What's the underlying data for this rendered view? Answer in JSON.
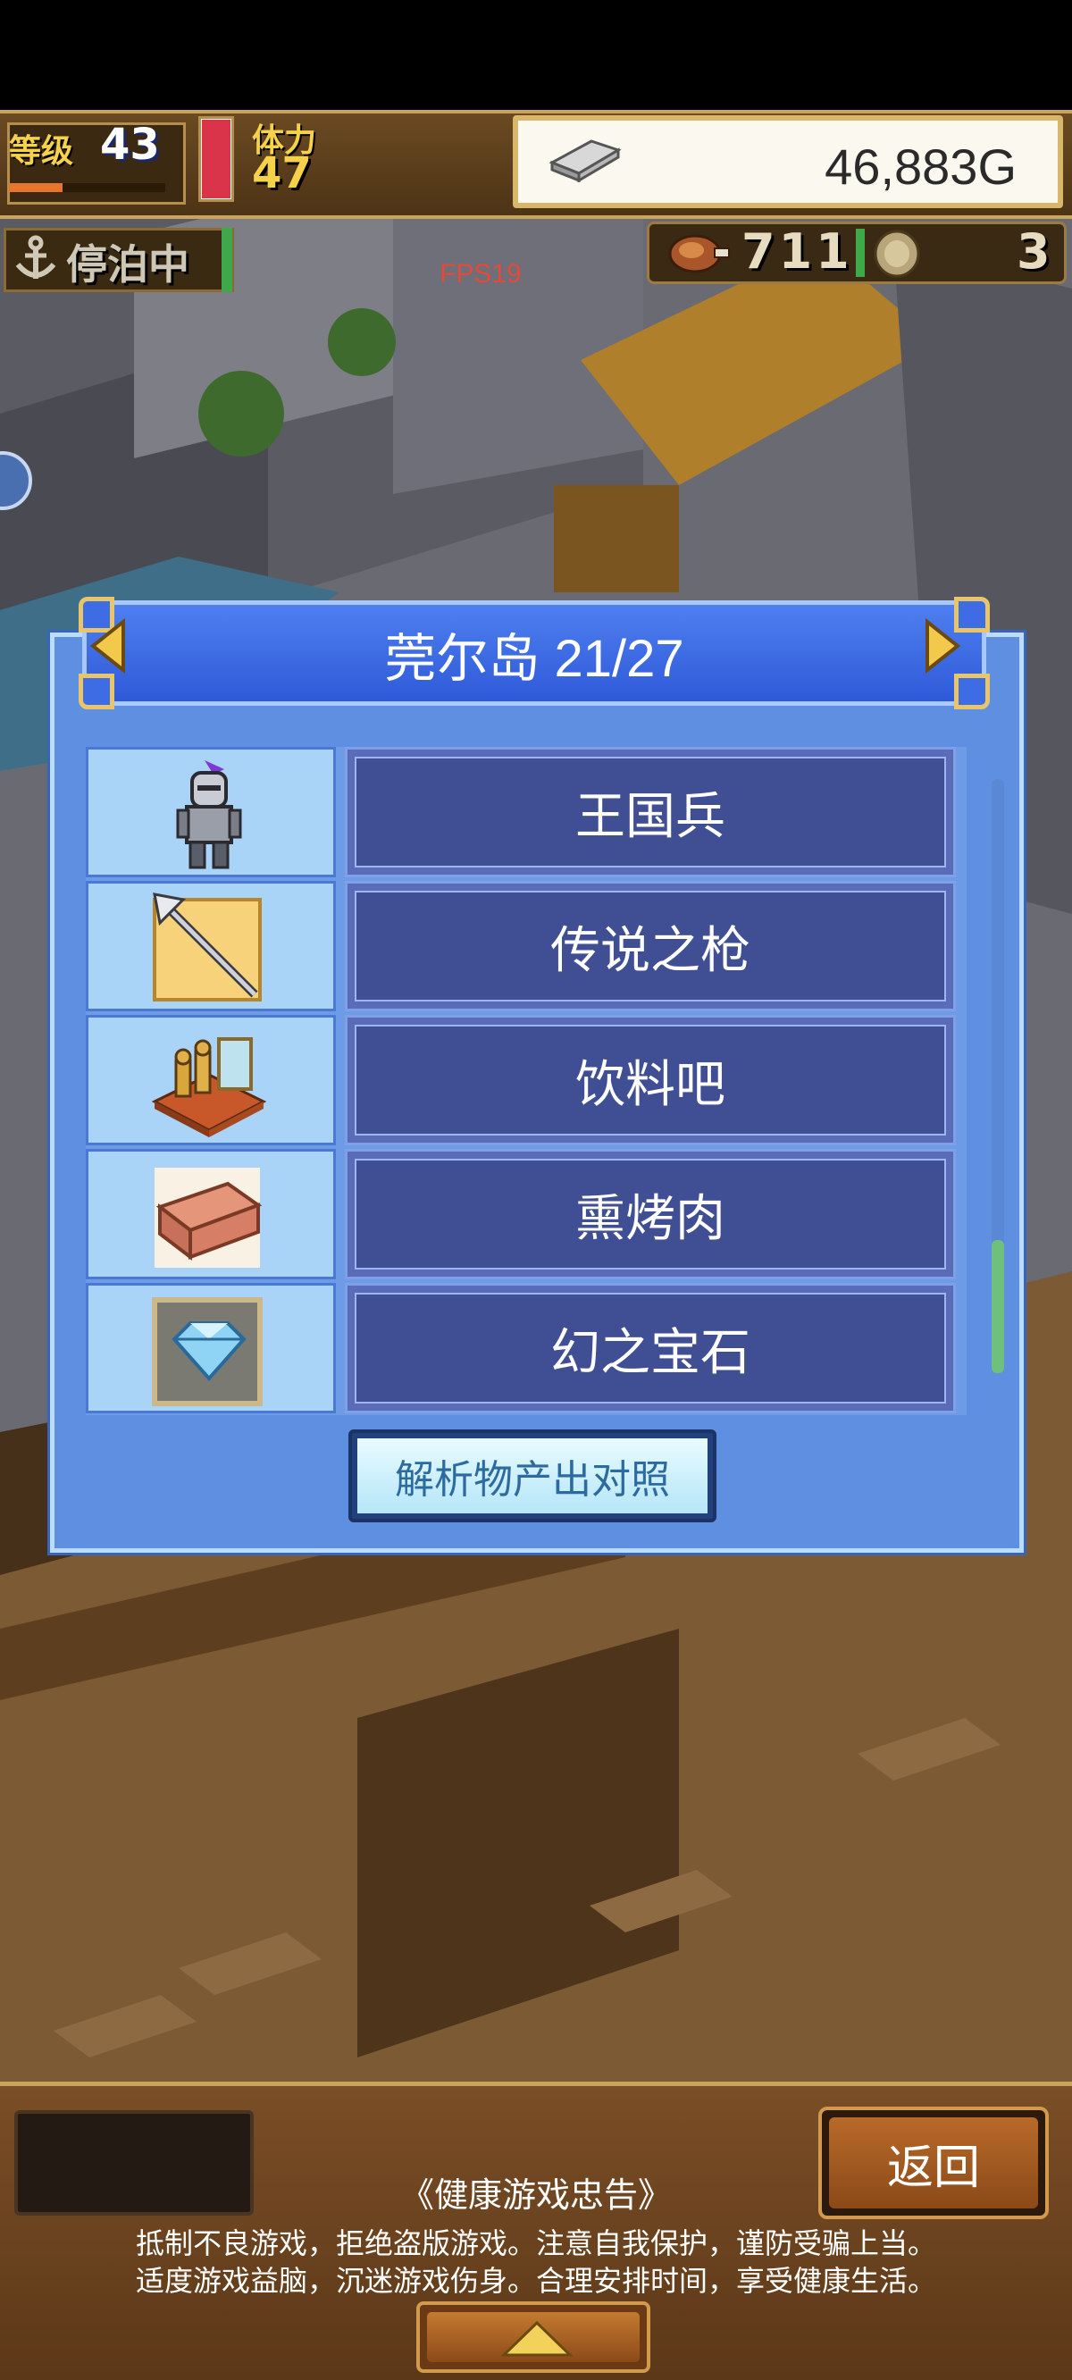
{
  "hud": {
    "level_label": "等级",
    "level_value": "43",
    "stamina_label": "体力",
    "stamina_value": "47",
    "gold": "46,883G",
    "dock_status": "停泊中",
    "fps": "FPS19",
    "food_count": "711",
    "coin_count": "3"
  },
  "dialog": {
    "title": "莞尔岛 21/27",
    "items": [
      {
        "name": "王国兵",
        "icon": "knight-icon"
      },
      {
        "name": "传说之枪",
        "icon": "spear-icon"
      },
      {
        "name": "饮料吧",
        "icon": "drink-bar-icon"
      },
      {
        "name": "熏烤肉",
        "icon": "smoked-meat-icon"
      },
      {
        "name": "幻之宝石",
        "icon": "diamond-icon"
      }
    ],
    "analyze_button": "解析物产出对照"
  },
  "bottom": {
    "back_button": "返回",
    "notice_title": "《健康游戏忠告》",
    "notice_line1": "抵制不良游戏，拒绝盗版游戏。注意自我保护，谨防受骗上当。",
    "notice_line2": "适度游戏益脑，沉迷游戏伤身。合理安排时间，享受健康生活。"
  },
  "colors": {
    "dialog_bg": "#5f8fe0",
    "item_name_bg": "#404e93",
    "gold_accent": "#f5d24a"
  }
}
